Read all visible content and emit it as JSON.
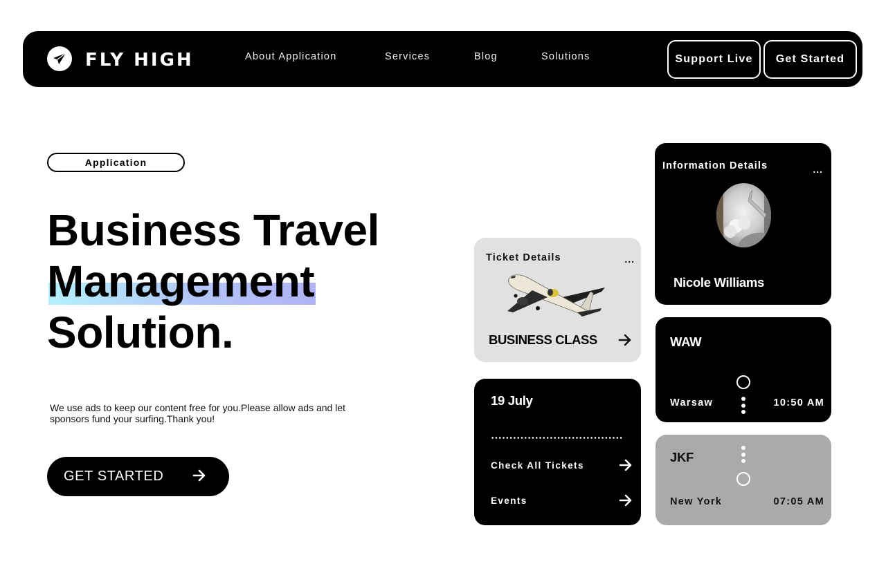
{
  "navbar": {
    "brand": "FLY HIGH",
    "logo_icon": "paper-plane-icon",
    "links": [
      {
        "label": "About Application"
      },
      {
        "label": "Services"
      },
      {
        "label": "Blog"
      },
      {
        "label": "Solutions"
      }
    ],
    "buttons": {
      "support_live": "Support Live",
      "get_started": "Get Started"
    }
  },
  "hero": {
    "tag": "Application",
    "headline": {
      "line1": "Business Travel",
      "line2": "Management",
      "line3": "Solution."
    },
    "highlight_colors": [
      "#b4f0fc",
      "#b0b3f6"
    ],
    "description": "We use ads to keep our content free for you.Please allow ads and let sponsors fund your surfing.Thank you!",
    "cta_label": "GET STARTED",
    "cta_icon": "arrow-right-icon"
  },
  "cards": {
    "ticket": {
      "title": "Ticket Details",
      "menu": "...",
      "image": "airplane-image",
      "class_label": "BUSINESS CLASS",
      "icon": "arrow-right-icon"
    },
    "info": {
      "title": "Information Details",
      "menu": "...",
      "image": "airplane-window-image",
      "name": "Nicole Williams"
    },
    "dates": {
      "date": "19 July",
      "links": [
        {
          "label": "Check All Tickets"
        },
        {
          "label": "Events"
        }
      ]
    },
    "departure": {
      "code": "WAW",
      "city": "Warsaw",
      "time": "10:50 AM"
    },
    "arrival": {
      "code": "JKF",
      "city": "New York",
      "time": "07:05 AM"
    }
  }
}
